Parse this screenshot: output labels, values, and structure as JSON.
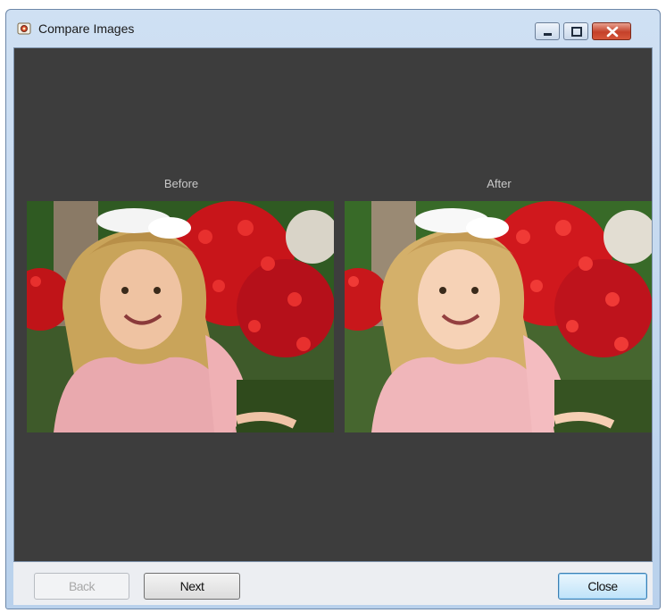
{
  "window": {
    "title": "Compare Images"
  },
  "icons": {
    "app": "app-icon",
    "minimize": "minimize-icon",
    "maximize": "maximize-icon",
    "close": "close-icon"
  },
  "canvas": {
    "before_label": "Before",
    "after_label": "After"
  },
  "footer": {
    "back_label": "Back",
    "next_label": "Next",
    "close_label": "Close"
  },
  "colors": {
    "canvas_bg": "#3d3d3d",
    "label_text": "#c8c8c8",
    "close_button_red": "#c4412a"
  }
}
